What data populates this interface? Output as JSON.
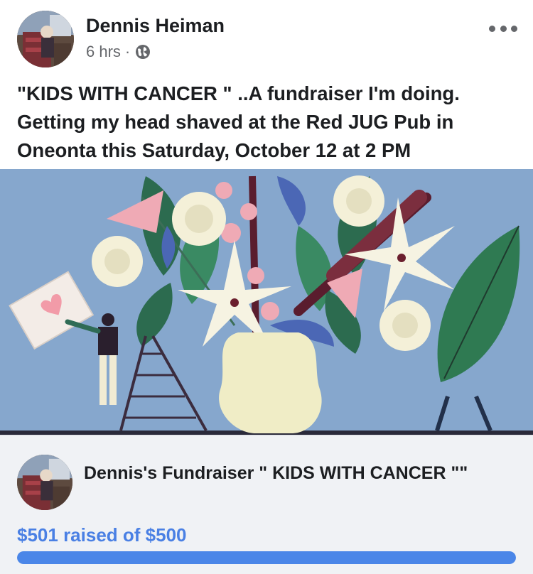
{
  "post": {
    "author": "Dennis Heiman",
    "time": "6 hrs",
    "separator": "·",
    "privacy_icon": "globe-icon",
    "more_icon": "more-options-icon",
    "text": "\"KIDS WITH CANCER \" ..A fundraiser I'm doing.\nGetting my head shaved at the Red JUG Pub in\nOneonta  this Saturday, October 12 at 2 PM"
  },
  "fundraiser": {
    "title": "Dennis's Fundraiser \" KIDS WITH CANCER \"\"",
    "raised_text": "$501 raised of $500",
    "progress_fraction": 1.0,
    "colors": {
      "accent": "#4a80e4",
      "card_bg": "#f0f2f5"
    }
  }
}
